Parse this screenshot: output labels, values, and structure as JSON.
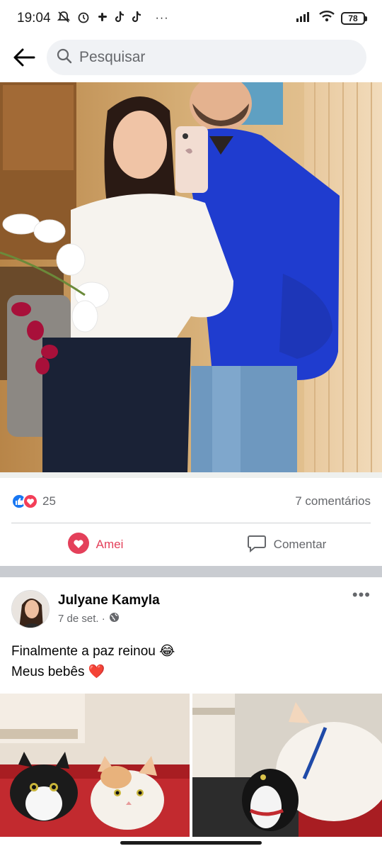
{
  "status_bar": {
    "time": "19:04",
    "more": "···",
    "battery": "78"
  },
  "search": {
    "placeholder": "Pesquisar"
  },
  "post1": {
    "reaction_count": "25",
    "comments": "7 comentários",
    "love_label": "Amei",
    "comment_label": "Comentar"
  },
  "post2": {
    "author": "Julyane Kamyla",
    "date": "7 de set. ·",
    "line1": "Finalmente a paz reinou 😂",
    "line2": "Meus bebês ❤️",
    "more": "•••"
  },
  "colors": {
    "love": "#e4405a",
    "like": "#1877f2",
    "muted": "#65676b"
  }
}
